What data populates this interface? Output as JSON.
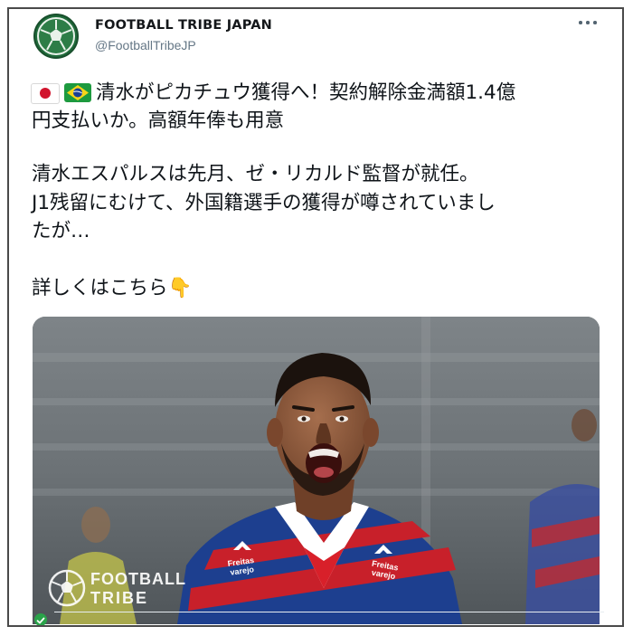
{
  "tweet": {
    "author_name": "FOOTBALL TRIBE JAPAN",
    "author_handle": "@FootballTribeJP",
    "more_icon": "ellipsis-icon",
    "flags": [
      "japan-flag-icon",
      "brazil-flag-icon"
    ],
    "lines": [
      "清水がピカチュウ獲得へ！契約解除金満額1.4億",
      "円支払いか。高額年俸も用意",
      "清水エスパルスは先月、ゼ・リカルド監督が就任。",
      "J1残留にむけて、外国籍選手の獲得が噂されていまし",
      "たが…",
      "詳しくはこちら"
    ],
    "pointing_emoji": "👇"
  },
  "media": {
    "watermark_line1": "FOOTBALL",
    "watermark_line2": "TRIBE",
    "jersey_sponsor": "Freitas varejo"
  },
  "colors": {
    "avatar_green": "#1f6a3a",
    "text": "#0f1419",
    "muted": "#657786",
    "jersey_red": "#c8202a",
    "jersey_blue": "#1d3f8f"
  }
}
